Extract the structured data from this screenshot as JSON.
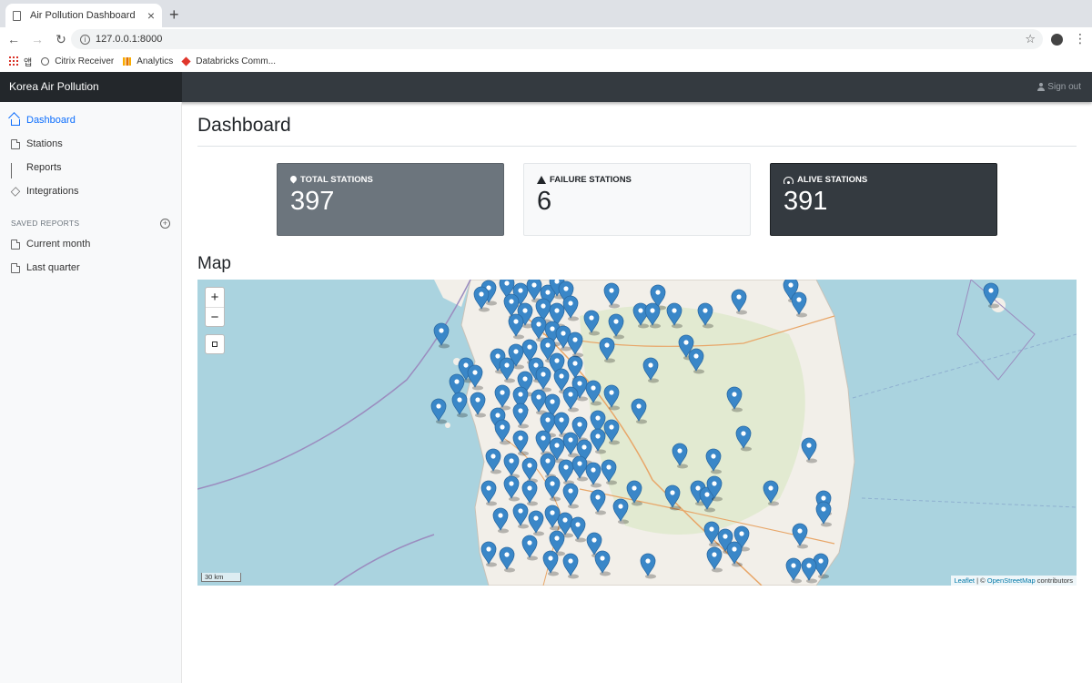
{
  "browser": {
    "tab_title": "Air Pollution Dashboard",
    "new_tab": "+",
    "url": "127.0.0.1:8000",
    "bookmarks": [
      {
        "label": "앱"
      },
      {
        "label": "Citrix Receiver"
      },
      {
        "label": "Analytics"
      },
      {
        "label": "Databricks Comm..."
      }
    ]
  },
  "header": {
    "brand": "Korea Air Pollution",
    "signout": "Sign out"
  },
  "sidebar": {
    "items": [
      {
        "label": "Dashboard",
        "icon": "home-icon"
      },
      {
        "label": "Stations",
        "icon": "file-icon"
      },
      {
        "label": "Reports",
        "icon": "bar-chart-icon"
      },
      {
        "label": "Integrations",
        "icon": "layers-icon"
      }
    ],
    "saved_heading": "SAVED REPORTS",
    "saved": [
      {
        "label": "Current month",
        "icon": "file-text-icon"
      },
      {
        "label": "Last quarter",
        "icon": "file-text-icon"
      }
    ]
  },
  "main": {
    "title": "Dashboard",
    "cards": {
      "total": {
        "label": "TOTAL STATIONS",
        "value": "397"
      },
      "failure": {
        "label": "FAILURE STATIONS",
        "value": "6"
      },
      "alive": {
        "label": "ALIVE STATIONS",
        "value": "391"
      }
    },
    "map_title": "Map",
    "map": {
      "zoom_in": "+",
      "zoom_out": "−",
      "scale": "30 km",
      "attrib_leaflet": "Leaflet",
      "attrib_sep": " | © ",
      "attrib_osm": "OpenStreetMap",
      "attrib_tail": " contributors",
      "marker_color": "#3a87c8"
    }
  }
}
